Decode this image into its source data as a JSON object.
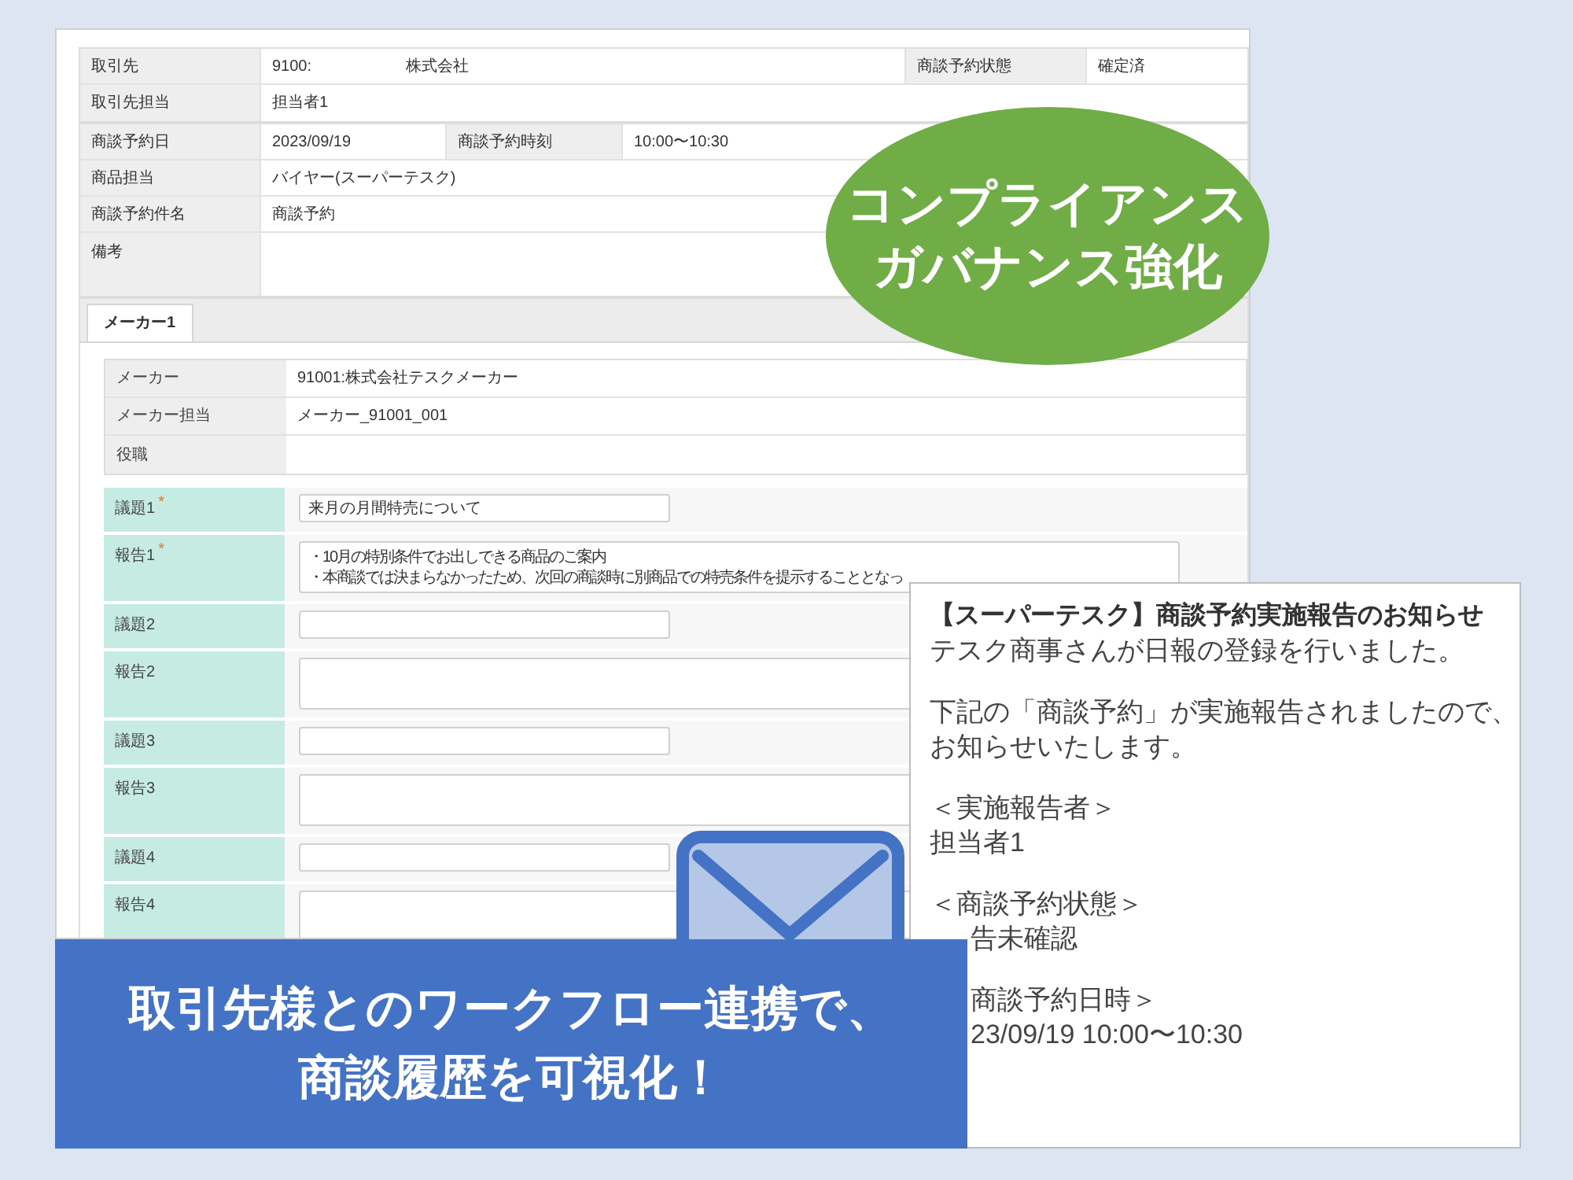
{
  "deal_table": [
    [
      {
        "kind": "label",
        "texts": [
          "取引先"
        ]
      },
      {
        "kind": "value",
        "texts": [
          "9100:",
          "株式会社"
        ]
      },
      {
        "kind": "label",
        "texts": [
          "商談予約状態"
        ]
      },
      {
        "kind": "value",
        "texts": [
          "確定済"
        ]
      }
    ],
    [
      {
        "kind": "label",
        "texts": [
          "取引先担当"
        ]
      },
      {
        "kind": "value",
        "texts": [
          "担当者1"
        ]
      }
    ]
  ],
  "schedule_table": [
    [
      {
        "kind": "label",
        "texts": [
          "商談予約日"
        ]
      },
      {
        "kind": "value",
        "texts": [
          "2023/09/19"
        ]
      },
      {
        "kind": "label",
        "texts": [
          "商談予約時刻"
        ]
      },
      {
        "kind": "value",
        "texts": [
          "10:00〜10:30"
        ]
      }
    ],
    [
      {
        "kind": "label",
        "texts": [
          "商品担当"
        ]
      },
      {
        "kind": "value",
        "texts": [
          "バイヤー(スーパーテスク)"
        ]
      }
    ],
    [
      {
        "kind": "label",
        "texts": [
          "商談予約件名"
        ]
      },
      {
        "kind": "value",
        "texts": [
          "商談予約"
        ]
      }
    ],
    [
      {
        "kind": "label",
        "texts": [
          "備考"
        ]
      }
    ]
  ],
  "tabs": [
    {
      "label": "メーカー1",
      "selected": true
    }
  ],
  "maker_table": [
    {
      "label": "メーカー",
      "value": "91001:株式会社テスクメーカー"
    },
    {
      "label": "メーカー担当",
      "value": "メーカー_91001_001"
    },
    {
      "label": "役職"
    }
  ],
  "agenda": [
    {
      "kind": "topic",
      "label": "議題1",
      "mark": "*",
      "value": "来月の月間特売について"
    },
    {
      "kind": "report",
      "label": "報告1",
      "mark": "*",
      "lines": [
        "・10月の特別条件でお出しできる商品のご案内",
        "・本商談では決まらなかったため、次回の商談時に別商品での特売条件を提示することとなっ"
      ]
    },
    {
      "kind": "topic",
      "label": "議題2"
    },
    {
      "kind": "report",
      "label": "報告2"
    },
    {
      "kind": "topic",
      "label": "議題3"
    },
    {
      "kind": "report",
      "label": "報告3"
    },
    {
      "kind": "topic",
      "label": "議題4"
    },
    {
      "kind": "report",
      "label": "報告4"
    }
  ],
  "callout": {
    "lines": [
      "コンプライアンス",
      "ガバナンス強化"
    ]
  },
  "email": {
    "title": "【スーパーテスク】商談予約実施報告のお知らせ",
    "paragraphs": [
      [
        {
          "text": "テスク商事さんが日報の登録を行いました。"
        }
      ],
      [
        {
          "text": "下記の「商談予約」が実施報告されましたので、"
        },
        {
          "text": "お知らせいたします。"
        }
      ],
      [
        {
          "text": "＜実施報告者＞"
        },
        {
          "text": "担当者1"
        }
      ],
      [
        {
          "text": "＜商談予約状態＞"
        },
        {
          "text": "告未確認",
          "cut": true
        }
      ],
      [
        {
          "text": "商談予約日時＞",
          "cut": true
        },
        {
          "text": "23/09/19 10:00〜10:30",
          "cut": true
        }
      ]
    ]
  },
  "banner": {
    "lines": [
      "取引先様とのワークフロー連携で、",
      "商談履歴を可視化！"
    ]
  }
}
